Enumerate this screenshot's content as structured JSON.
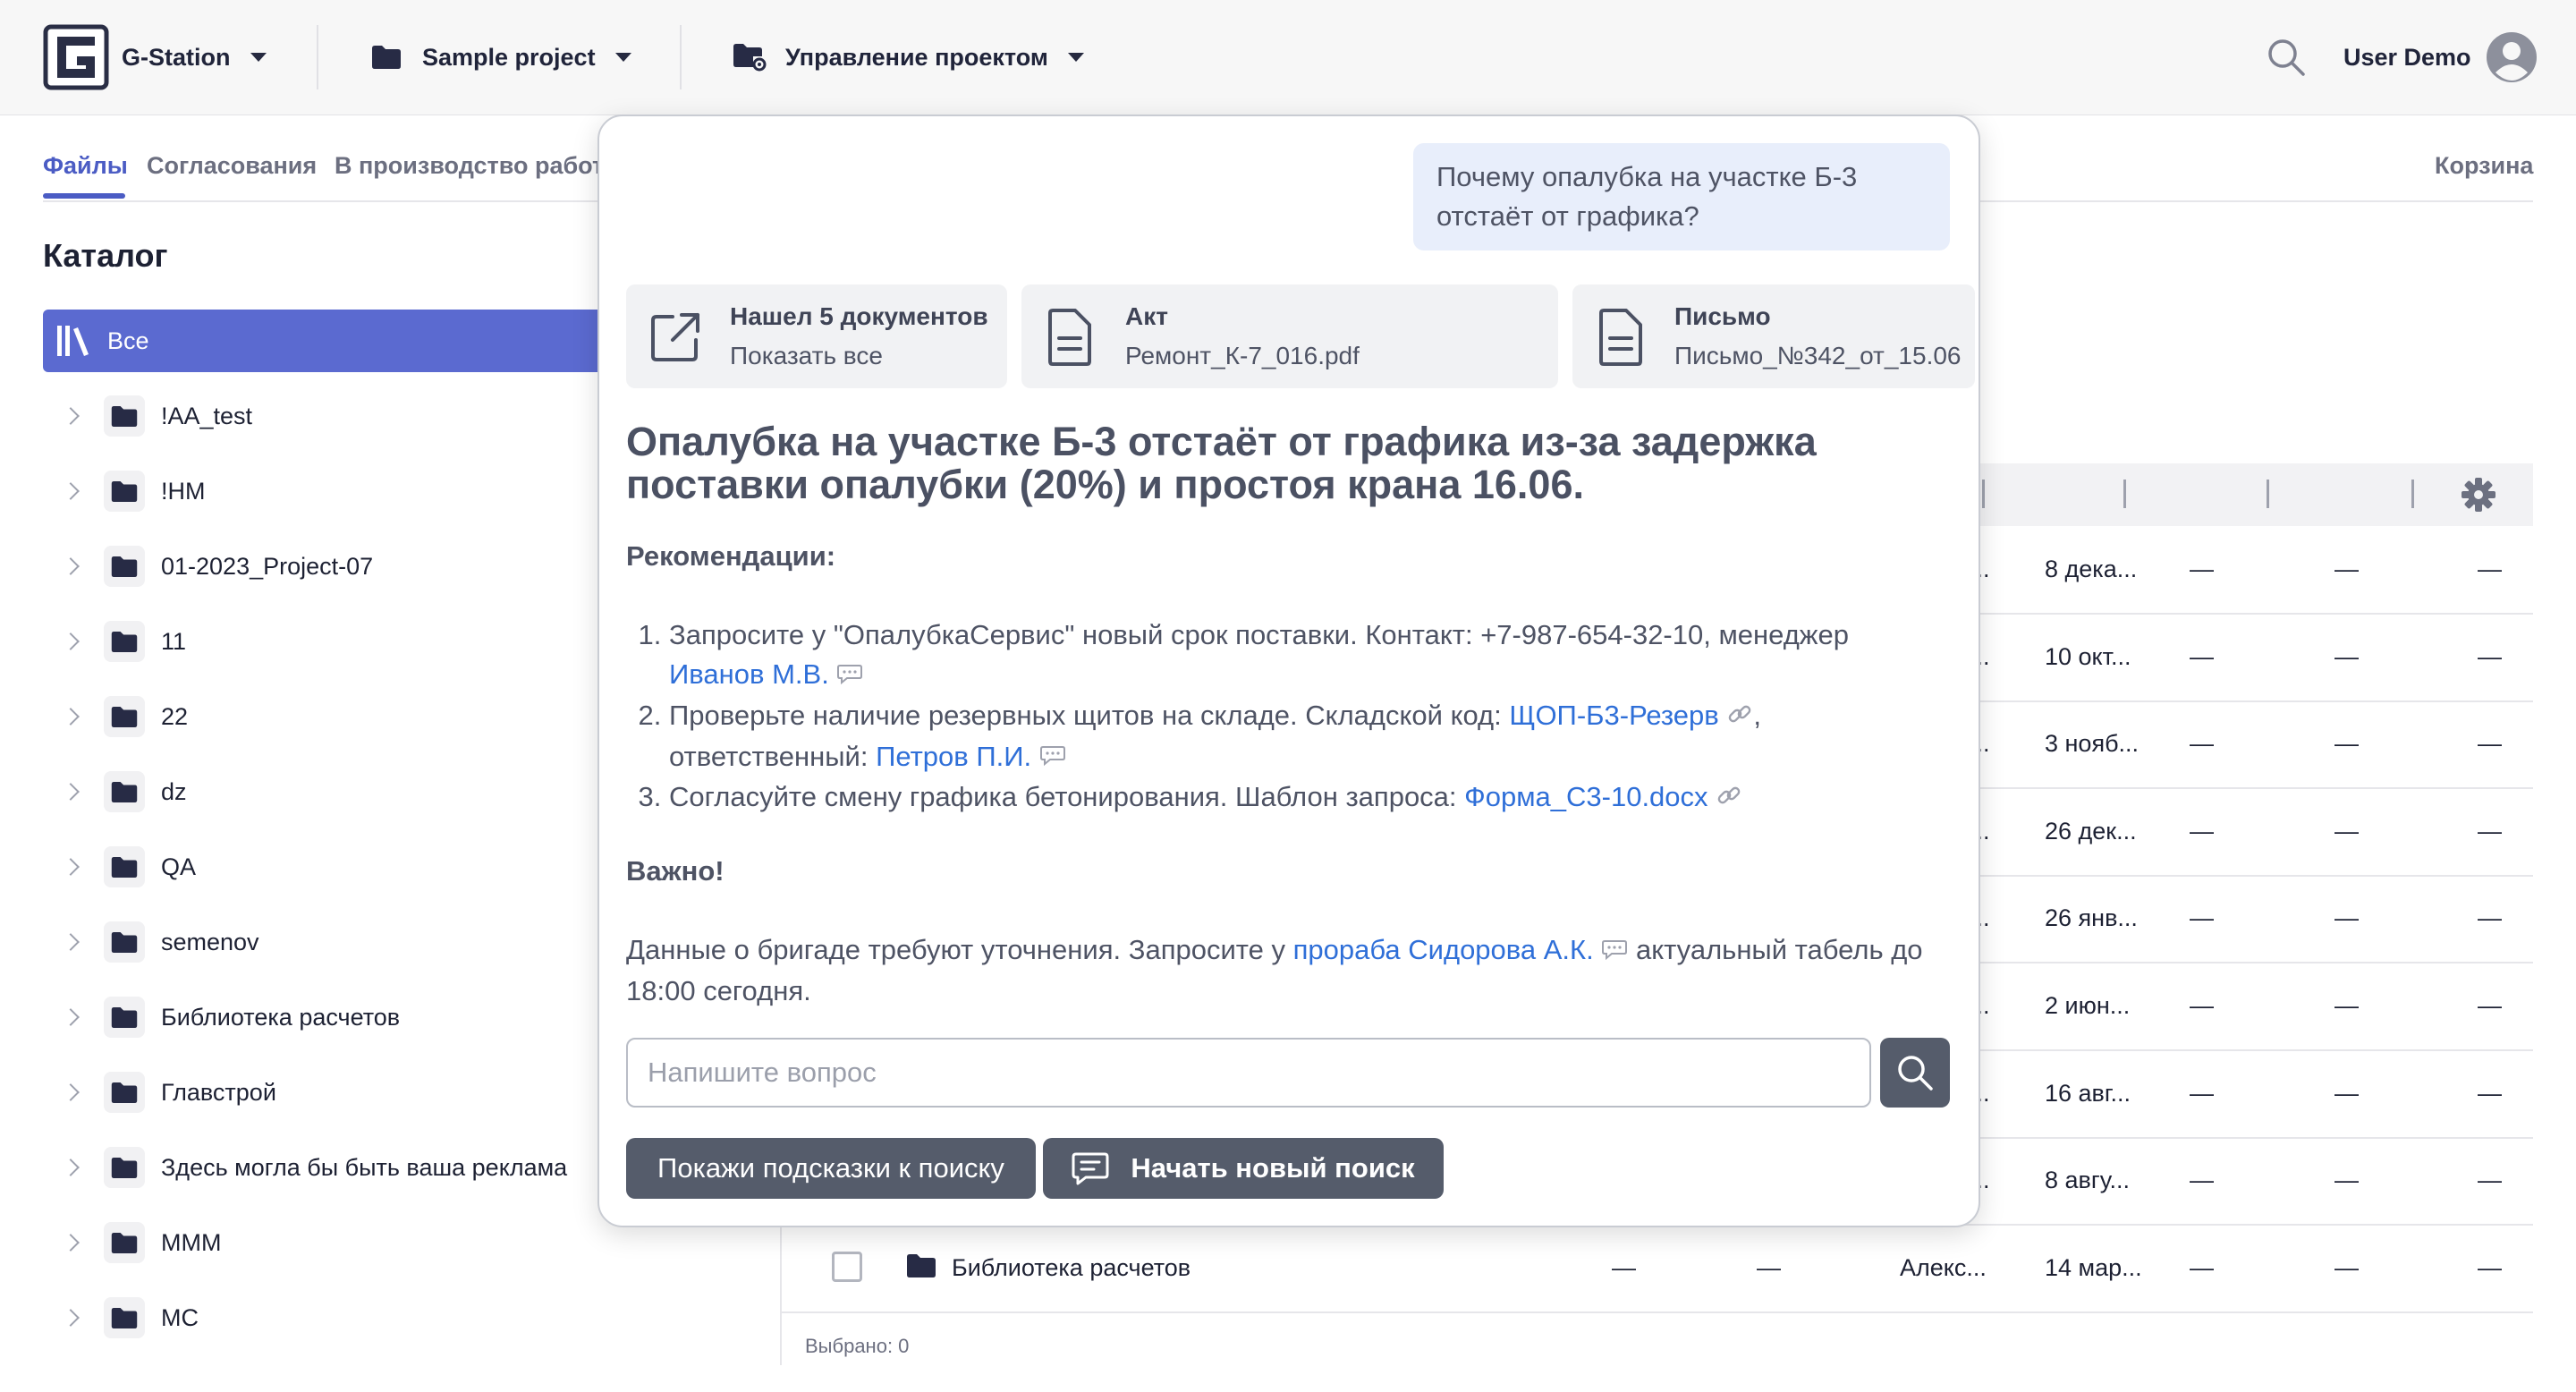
{
  "topbar": {
    "app_name": "G-Station",
    "project": "Sample project",
    "manage": "Управление проектом",
    "user": "User Demo"
  },
  "tabs": [
    "Файлы",
    "Согласования",
    "В производство работ"
  ],
  "trash": "Корзина",
  "catalog": {
    "title": "Каталог",
    "all": "Все",
    "items": [
      "!AA_test",
      "!HM",
      "01-2023_Project-07",
      "11",
      "22",
      "dz",
      "QA",
      "semenov",
      "Библиотека расчетов",
      "Главстрой",
      "Здесь могла бы быть ваша реклама",
      "MMM",
      "MC"
    ]
  },
  "table": {
    "rows": [
      {
        "author": "...",
        "date": "8 дека...",
        "c1": "—",
        "c2": "—",
        "c3": "—"
      },
      {
        "author": "...",
        "date": "10 окт...",
        "c1": "—",
        "c2": "—",
        "c3": "—"
      },
      {
        "author": "...",
        "date": "3 нояб...",
        "c1": "—",
        "c2": "—",
        "c3": "—"
      },
      {
        "author": "...",
        "date": "26 дек...",
        "c1": "—",
        "c2": "—",
        "c3": "—"
      },
      {
        "author": "...",
        "date": "26 янв...",
        "c1": "—",
        "c2": "—",
        "c3": "—"
      },
      {
        "author": "...",
        "date": "2 июн...",
        "c1": "—",
        "c2": "—",
        "c3": "—"
      },
      {
        "author": "...",
        "date": "16 авг...",
        "c1": "—",
        "c2": "—",
        "c3": "—"
      },
      {
        "author": "...",
        "date": "8 авгу...",
        "c1": "—",
        "c2": "—",
        "c3": "—"
      }
    ],
    "last_row": {
      "name": "Библиотека расчетов",
      "d1": "—",
      "d2": "—",
      "author": "Алекс...",
      "date": "14 мар...",
      "c1": "—",
      "c2": "—",
      "c3": "—"
    },
    "selected": "Выбрано: 0"
  },
  "assistant": {
    "question": "Почему опалубка на участке Б-3 отстаёт от графика?",
    "cards": [
      {
        "title": "Нашел 5 документов",
        "sub": "Показать все"
      },
      {
        "title": "Акт",
        "sub": "Ремонт_К-7_016.pdf"
      },
      {
        "title": "Письмо",
        "sub": "Письмо_№342_от_15.06"
      }
    ],
    "answer_title": "Опалубка на участке Б-3 отстаёт от графика из-за задержка поставки опалубки (20%) и простоя крана 16.06.",
    "recommendations_label": "Рекомендации:",
    "rec1_text": "Запросите у \"ОпалубкаСервис\" новый срок поставки. Контакт: +7-987-654-32-10, менеджер",
    "rec1_link": "Иванов М.В.",
    "rec2_text": "Проверьте наличие резервных щитов на складе. Складской код:",
    "rec2_link": "ЩОП-Б3-Резерв",
    "rec2_text2": ", ответственный:",
    "rec2_link2": "Петров П.И.",
    "rec3_text": "Согласуйте смену графика бетонирования. Шаблон запроса:",
    "rec3_link": "Форма_С3-10.docx",
    "important_label": "Важно!",
    "important_text1": "Данные о бригаде требуют уточнения. Запросите у",
    "important_link": "прораба Сидорова А.К.",
    "important_text2": "актуальный табель до 18:00 сегодня.",
    "input_placeholder": "Напишите вопрос",
    "hints_button": "Покажи подсказки к поиску",
    "new_search_button": "Начать новый поиск"
  }
}
